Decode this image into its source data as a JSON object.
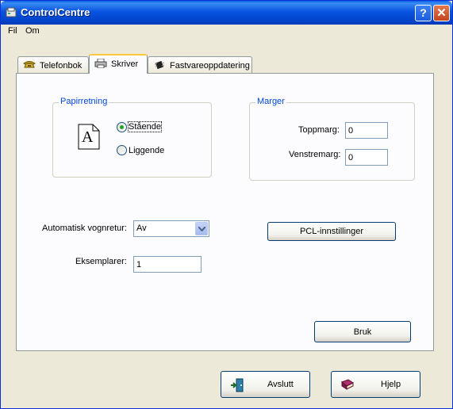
{
  "window": {
    "title": "ControlCentre"
  },
  "title_buttons": {
    "help": "?",
    "close": "✕"
  },
  "menu": {
    "items": [
      "Fil",
      "Om"
    ]
  },
  "tabs": [
    {
      "label": "Telefonbok",
      "icon": "phone-icon"
    },
    {
      "label": "Skriver",
      "icon": "printer-icon",
      "active": true
    },
    {
      "label": "Fastvareoppdatering",
      "icon": "chip-icon"
    }
  ],
  "paper_orientation": {
    "legend": "Papirretning",
    "glyph": "A",
    "options": [
      {
        "label": "Stående",
        "selected": true
      },
      {
        "label": "Liggende",
        "selected": false
      }
    ]
  },
  "margins": {
    "legend": "Marger",
    "top_label": "Toppmarg:",
    "top_value": "0",
    "left_label": "Venstremarg:",
    "left_value": "0"
  },
  "auto_return": {
    "label": "Automatisk vognretur:",
    "value": "Av"
  },
  "copies": {
    "label": "Eksemplarer:",
    "value": "1"
  },
  "buttons": {
    "pcl": "PCL-innstillinger",
    "apply": "Bruk",
    "exit": "Avslutt",
    "help": "Hjelp"
  }
}
